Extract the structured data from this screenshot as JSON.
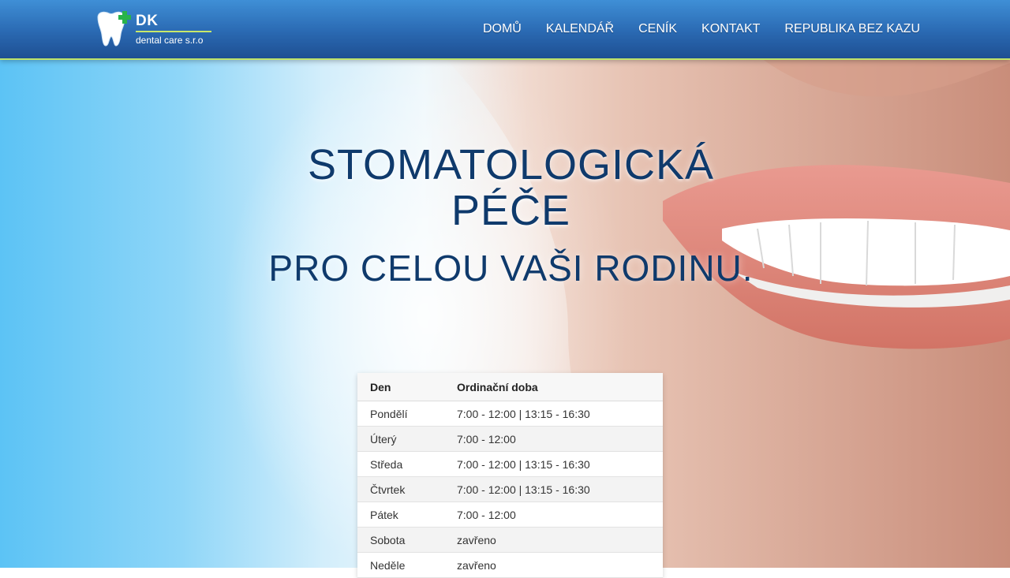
{
  "brand": {
    "name": "DK",
    "subtitle": "dental care s.r.o",
    "accent_color": "#c8e86a",
    "logo_icon": "tooth-plus-icon"
  },
  "nav": {
    "items": [
      {
        "label": "DOMŮ"
      },
      {
        "label": "KALENDÁŘ"
      },
      {
        "label": "CENÍK"
      },
      {
        "label": "KONTAKT"
      },
      {
        "label": "REPUBLIKA BEZ KAZU"
      }
    ]
  },
  "hero": {
    "title": "STOMATOLOGICKÁ PÉČE",
    "subtitle": "PRO CELOU VAŠI RODINU.",
    "title_color": "#0f3a6c"
  },
  "hours": {
    "headers": [
      "Den",
      "Ordinační doba"
    ],
    "rows": [
      [
        "Pondělí",
        "7:00 - 12:00 | 13:15 - 16:30"
      ],
      [
        "Úterý",
        "7:00 - 12:00"
      ],
      [
        "Středa",
        "7:00 - 12:00 | 13:15 - 16:30"
      ],
      [
        "Čtvrtek",
        "7:00 - 12:00 | 13:15 - 16:30"
      ],
      [
        "Pátek",
        "7:00 - 12:00"
      ],
      [
        "Sobota",
        "zavřeno"
      ],
      [
        "Neděle",
        "zavřeno"
      ]
    ]
  }
}
